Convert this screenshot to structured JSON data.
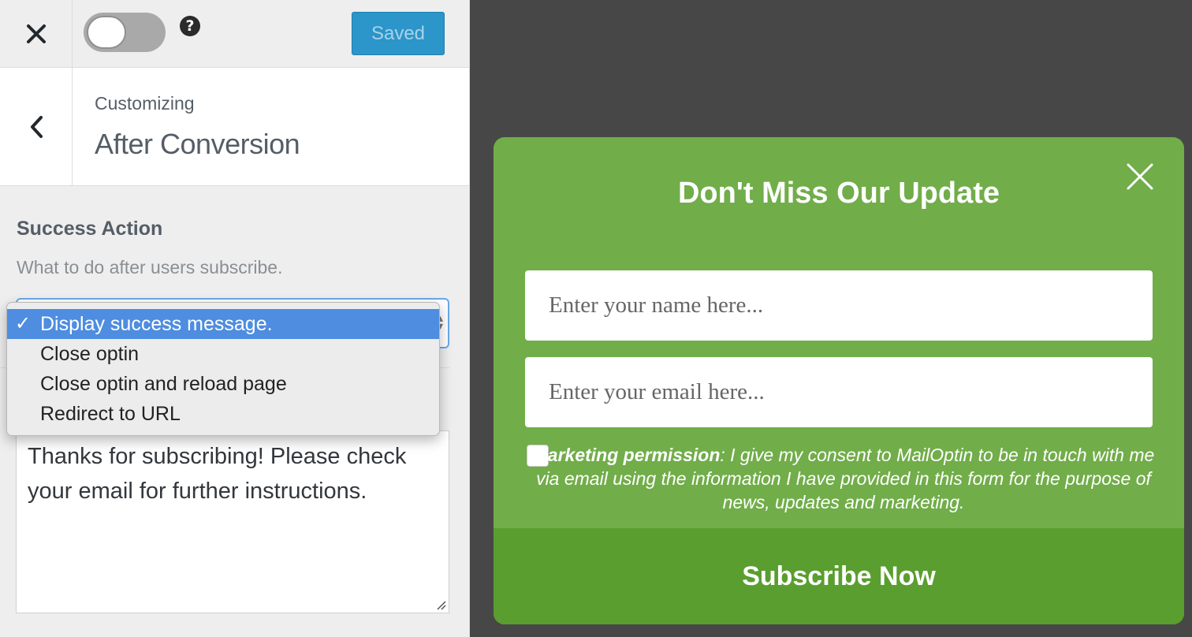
{
  "topbar": {
    "close_icon": "close-icon",
    "toggle_state": "off",
    "help_glyph": "?",
    "saved_label": "Saved"
  },
  "header": {
    "customizing_label": "Customizing",
    "section_title": "After Conversion"
  },
  "control": {
    "label": "Success Action",
    "description": "What to do after users subscribe.",
    "selected_option": "Display success message.",
    "options": [
      "Display success message.",
      "Close optin",
      "Close optin and reload page",
      "Redirect to URL"
    ]
  },
  "success_message": "Thanks for subscribing! Please check your email for further instructions.",
  "optin": {
    "title": "Don't Miss Our Update",
    "name_placeholder": "Enter your name here...",
    "email_placeholder": "Enter your email here...",
    "consent_bold": "Marketing permission",
    "consent_text": ": I give my consent to MailOptin to be in touch with me via email using the information I have provided in this form for the purpose of news, updates and marketing.",
    "button_label": "Subscribe Now"
  },
  "colors": {
    "optin_bg": "#71ad49",
    "button_bg": "#5a9e2f",
    "preview_bg": "#474747",
    "saved_bg": "#2c95c9",
    "dropdown_highlight": "#4e8de0"
  }
}
